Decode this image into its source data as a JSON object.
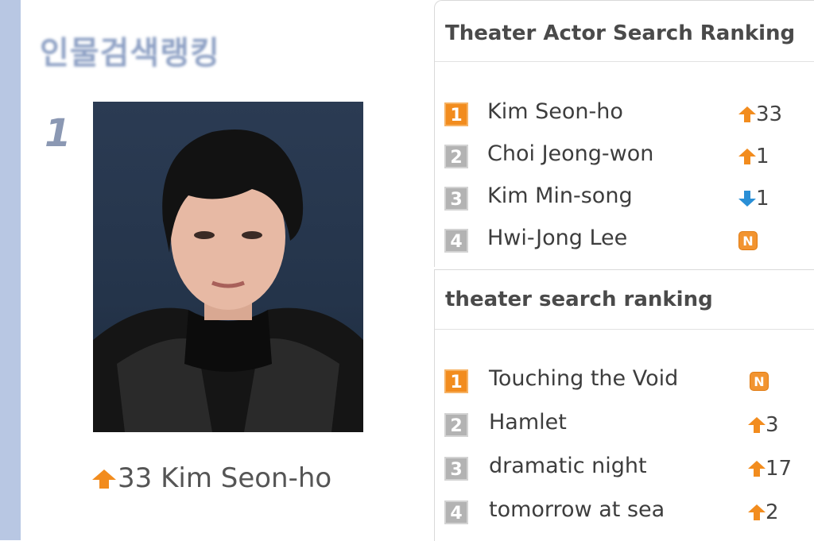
{
  "left": {
    "title": "인물검색랭킹",
    "rank": "1",
    "featured": {
      "change": "33",
      "name": "Kim Seon-ho"
    }
  },
  "actor_panel": {
    "title": "Theater Actor Search Ranking",
    "items": [
      {
        "rank": "1",
        "name": "Kim Seon-ho",
        "trend": "up",
        "change": "33"
      },
      {
        "rank": "2",
        "name": "Choi Jeong-won",
        "trend": "up",
        "change": "1"
      },
      {
        "rank": "3",
        "name": "Kim Min-song",
        "trend": "down",
        "change": "1"
      },
      {
        "rank": "4",
        "name": "Hwi-Jong Lee",
        "trend": "new",
        "change": "N"
      }
    ]
  },
  "theater_panel": {
    "title": "theater search ranking",
    "items": [
      {
        "rank": "1",
        "name": "Touching the Void",
        "trend": "new",
        "change": "N"
      },
      {
        "rank": "2",
        "name": "Hamlet",
        "trend": "up",
        "change": "3"
      },
      {
        "rank": "3",
        "name": "dramatic night",
        "trend": "up",
        "change": "17"
      },
      {
        "rank": "4",
        "name": "tomorrow at sea",
        "trend": "up",
        "change": "2"
      }
    ]
  },
  "colors": {
    "up": "#f28c1e",
    "down": "#2a8fd6",
    "sidebar": "#b8c7e3"
  },
  "icons": {
    "up": "up-arrow-icon",
    "down": "down-arrow-icon",
    "new": "new-badge-icon"
  }
}
